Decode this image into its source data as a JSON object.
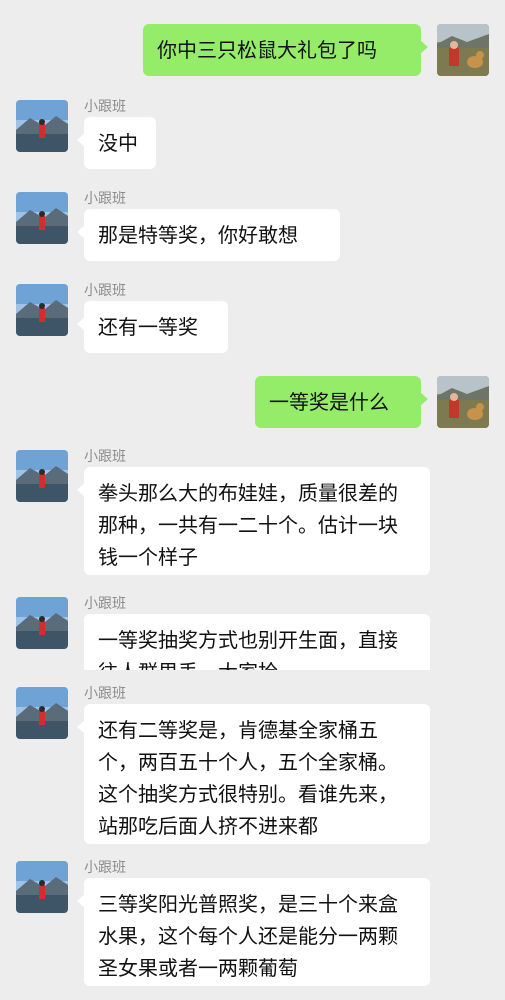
{
  "chat": {
    "contact_name": "小跟班",
    "messages": [
      {
        "sender": "me",
        "text": "你中三只松鼠大礼包了吗"
      },
      {
        "sender": "小跟班",
        "text": "没中"
      },
      {
        "sender": "小跟班",
        "text": "那是特等奖，你好敢想"
      },
      {
        "sender": "小跟班",
        "text": "还有一等奖"
      },
      {
        "sender": "me",
        "text": "一等奖是什么"
      },
      {
        "sender": "小跟班",
        "text": "拳头那么大的布娃娃，质量很差的那种，一共有一二十个。估计一块钱一个样子"
      },
      {
        "sender": "小跟班",
        "text": "一等奖抽奖方式也别开生面，直接往人群里丢，大家抢"
      },
      {
        "sender": "小跟班",
        "text": "还有二等奖是，肯德基全家桶五个，两百五十个人，五个全家桶。这个抽奖方式很特别。看谁先来，站那吃后面人挤不进来都"
      },
      {
        "sender": "小跟班",
        "text": "三等奖阳光普照奖，是三十个来盒水果，这个每个人还是能分一两颗圣女果或者一两颗葡萄"
      }
    ]
  },
  "colors": {
    "background": "#ededed",
    "outgoing_bubble": "#95ec69",
    "incoming_bubble": "#ffffff",
    "sender_name": "#8c8c8c"
  }
}
